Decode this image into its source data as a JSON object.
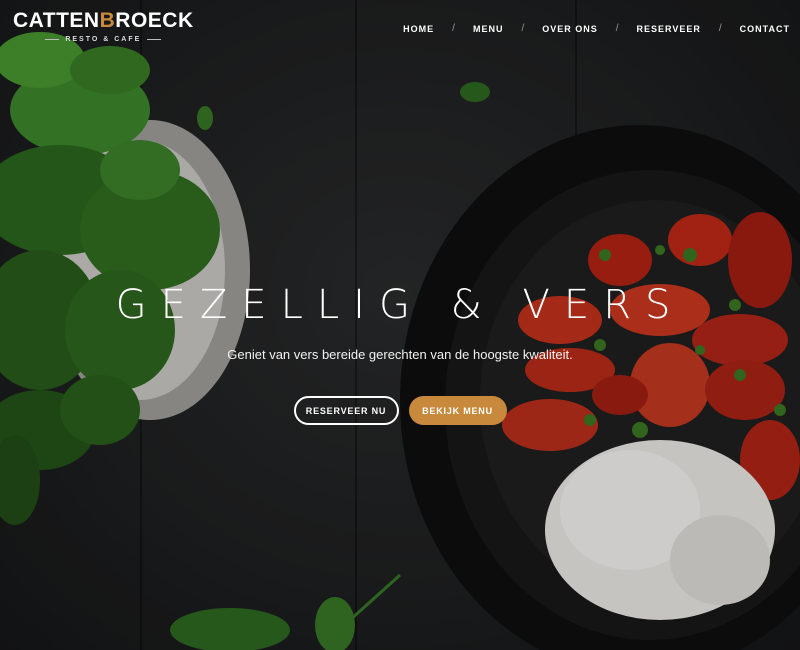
{
  "brand": {
    "name_part1": "CATTEN",
    "name_accent": "B",
    "name_part2": "ROECK",
    "tagline": "RESTO & CAFE"
  },
  "nav": {
    "items": [
      {
        "label": "HOME"
      },
      {
        "label": "MENU"
      },
      {
        "label": "OVER ONS"
      },
      {
        "label": "RESERVEER"
      },
      {
        "label": "CONTACT"
      }
    ],
    "separator": "/"
  },
  "hero": {
    "headline": "GEZELLIG & VERS",
    "subline": "Geniet van vers bereide gerechten van de hoogste kwaliteit.",
    "primary_button": "RESERVEER NU",
    "secondary_button": "BEKIJK MENU"
  },
  "colors": {
    "accent": "#c8893c",
    "background": "#1c1d1e",
    "text": "#ffffff"
  }
}
